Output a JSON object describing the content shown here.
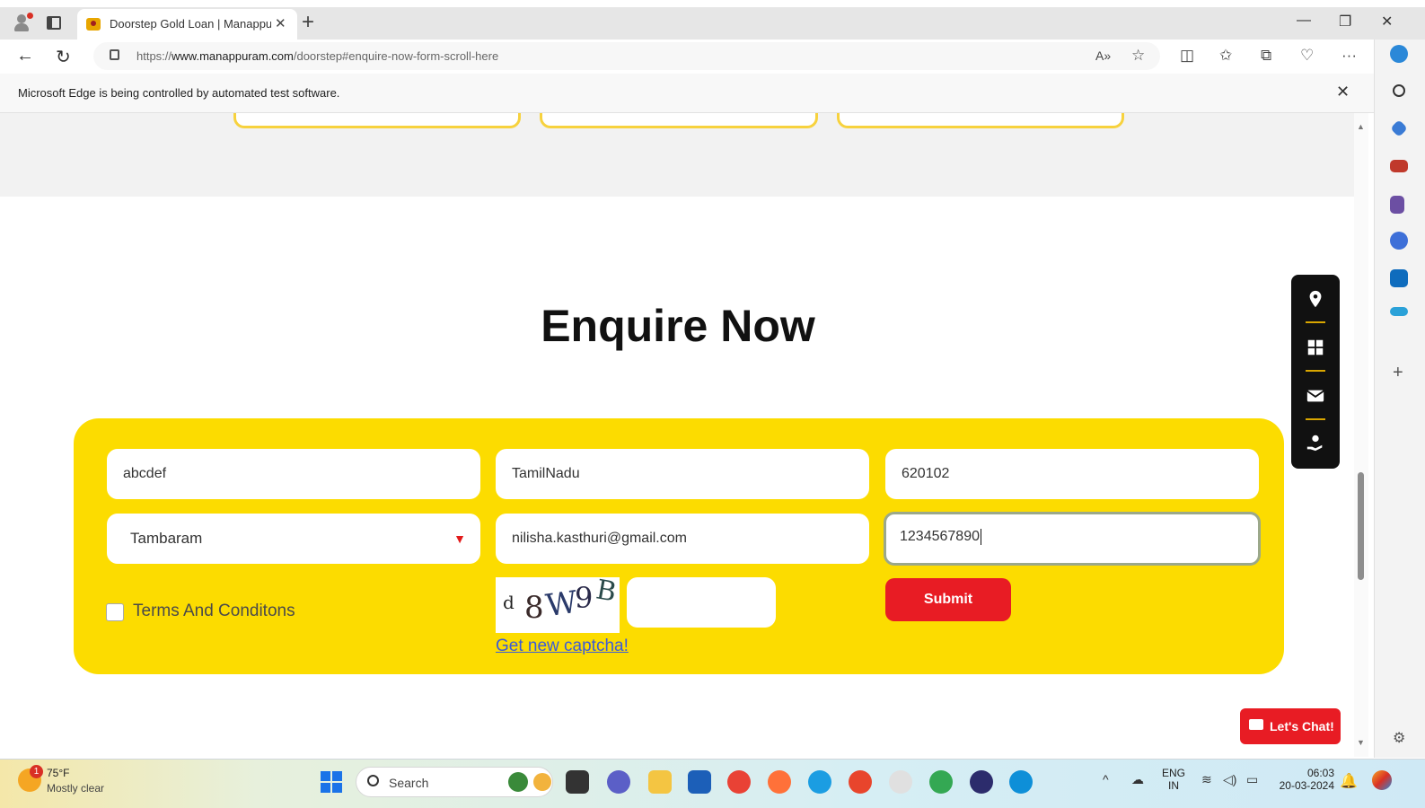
{
  "browser": {
    "tab_title": "Doorstep Gold Loan | Manappuram",
    "url_domain": "www.manappuram.com",
    "url_prefix": "https://",
    "url_path": "/doorstep#enquire-now-form-scroll-here",
    "infobar_message": "Microsoft Edge is being controlled by automated test software."
  },
  "page": {
    "heading": "Enquire Now",
    "form": {
      "name_value": "abcdef",
      "state_value": "TamilNadu",
      "pincode_value": "620102",
      "branch_selected": "Tambaram",
      "email_value": "nilisha.kasthuri@gmail.com",
      "phone_value": "1234567890",
      "terms_label": "Terms And Conditons",
      "captcha_text": "d8W9B",
      "captcha_link": "Get new captcha!",
      "submit_label": "Submit"
    },
    "chat_label": "Let's Chat!"
  },
  "taskbar": {
    "temperature": "75°F",
    "condition": "Mostly clear",
    "weather_badge": "1",
    "search_label": "Search",
    "lang_line1": "ENG",
    "lang_line2": "IN",
    "time": "06:03",
    "date": "20-03-2024"
  },
  "colors": {
    "form_bg": "#fcdc00",
    "accent_red": "#e81c24",
    "link_blue": "#3b5bd8"
  }
}
